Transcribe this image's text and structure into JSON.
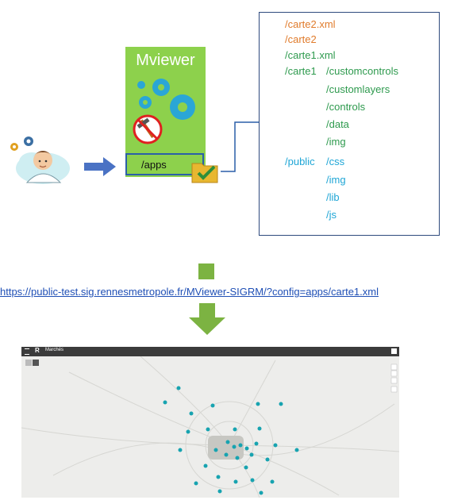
{
  "mviewer": {
    "title": "Mviewer",
    "apps_label": "/apps"
  },
  "tree": {
    "lines": [
      {
        "text": "/carte2.xml",
        "color": "orange"
      },
      {
        "text": "/carte2",
        "color": "orange"
      },
      {
        "text": "/carte1.xml",
        "color": "green"
      },
      {
        "text": "/carte1",
        "color": "green"
      },
      {
        "text": "/customcontrols",
        "color": "green"
      },
      {
        "text": "/customlayers",
        "color": "green"
      },
      {
        "text": "/controls",
        "color": "green"
      },
      {
        "text": "/data",
        "color": "green"
      },
      {
        "text": "/img",
        "color": "green"
      },
      {
        "text": "/public",
        "color": "blue"
      },
      {
        "text": "/css",
        "color": "blue"
      },
      {
        "text": "/img",
        "color": "blue"
      },
      {
        "text": "/lib",
        "color": "blue"
      },
      {
        "text": "/js",
        "color": "blue"
      }
    ]
  },
  "url": "https://public-test.sig.rennesmetropole.fr/MViewer-SIGRM/?config=apps/carte1.xml",
  "map": {
    "title": "Marchés",
    "logo": "R"
  },
  "colors": {
    "green": "#7cb342",
    "arrow_blue": "#4a72c4",
    "orange": "#e07b2b",
    "teal": "#17a3b0"
  },
  "icons": [
    "gear-icon",
    "user-avatar-icon",
    "no-tools-icon",
    "folder-check-icon",
    "map-marker-icon"
  ]
}
